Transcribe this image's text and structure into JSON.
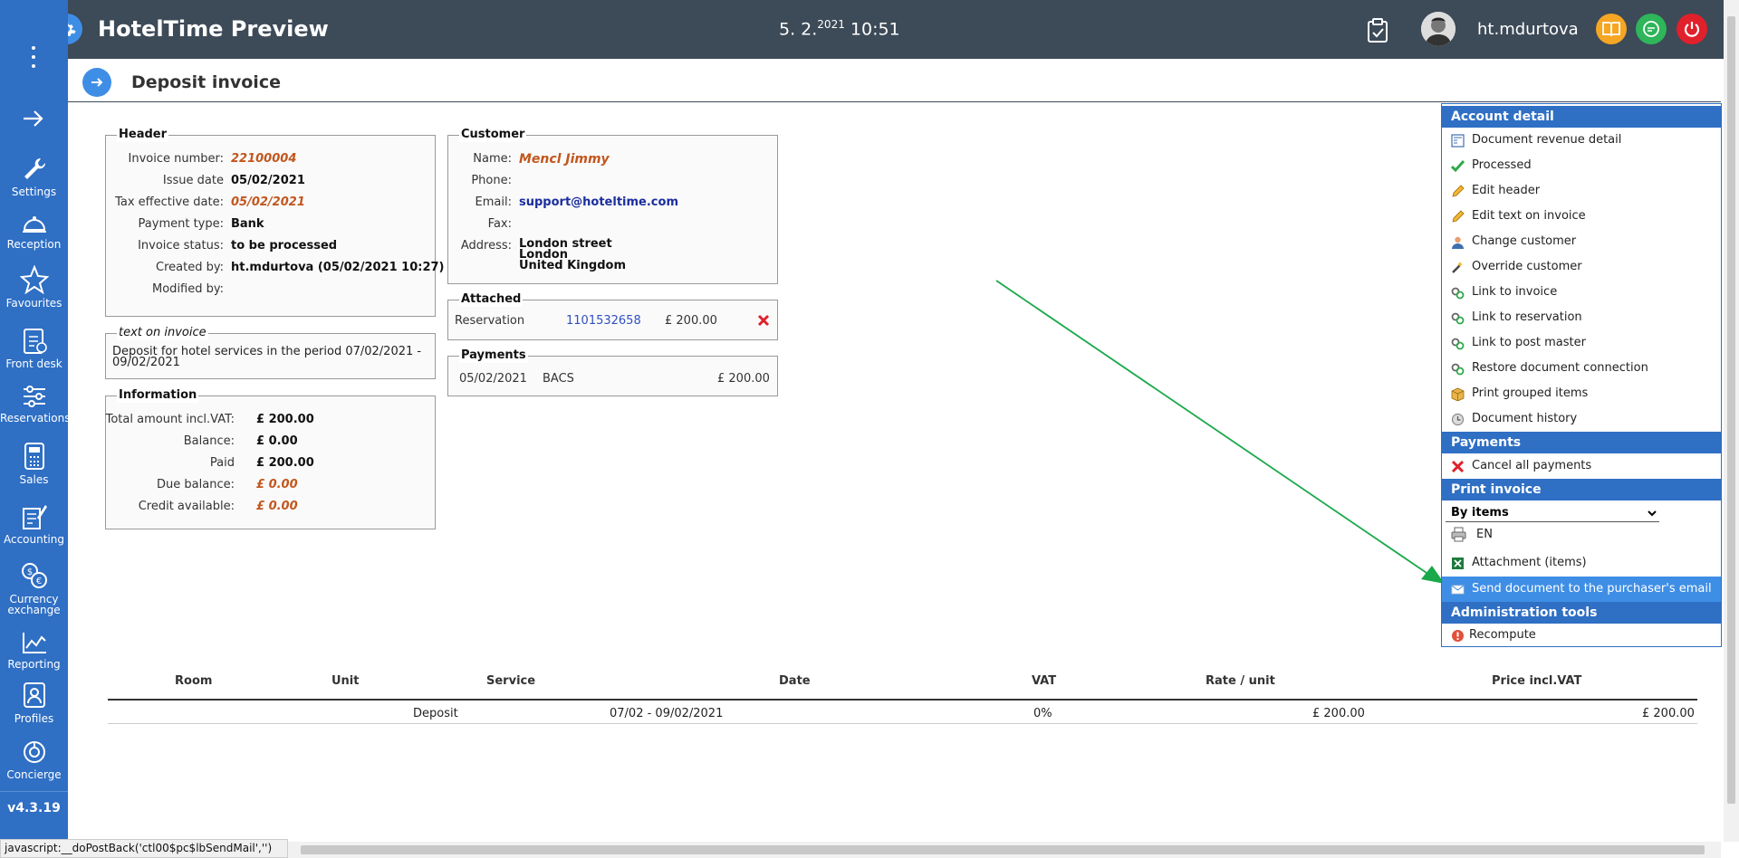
{
  "app": {
    "title": "HotelTime Preview",
    "date_main": "5. 2.",
    "date_year": "2021",
    "time": "10:51",
    "username": "ht.mdurtova"
  },
  "colors": {
    "topbar": "#3d4a58",
    "sidebar": "#2f6fc4",
    "accent": "#3f8ee6",
    "orange": "#c2561d",
    "arrow": "#19a84a"
  },
  "sidebar": {
    "items": [
      {
        "label": "Settings",
        "icon": "wrench-icon"
      },
      {
        "label": "Reception",
        "icon": "bell-icon"
      },
      {
        "label": "Favourites",
        "icon": "star-icon"
      },
      {
        "label": "Front desk",
        "icon": "clipboard-icon"
      },
      {
        "label": "Reservations",
        "icon": "sliders-icon"
      },
      {
        "label": "Sales",
        "icon": "calculator-icon"
      },
      {
        "label": "Accounting",
        "icon": "ledger-icon"
      },
      {
        "label": "Currency",
        "label2": "exchange",
        "icon": "currency-icon"
      },
      {
        "label": "Reporting",
        "icon": "chart-icon"
      },
      {
        "label": "Profiles",
        "icon": "profile-icon"
      },
      {
        "label": "Concierge",
        "icon": "concierge-icon"
      }
    ],
    "version": "v4.3.19"
  },
  "page": {
    "title": "Deposit invoice"
  },
  "header_box": {
    "title": "Header",
    "rows": [
      {
        "label": "Invoice number:",
        "value": "22100004"
      },
      {
        "label": "Issue date",
        "value": "05/02/2021"
      },
      {
        "label": "Tax effective date:",
        "value": "05/02/2021"
      },
      {
        "label": "Payment type:",
        "value": "Bank"
      },
      {
        "label": "Invoice status:",
        "value": "to be processed"
      },
      {
        "label": "Created by:",
        "value": "ht.mdurtova (05/02/2021 10:27)"
      },
      {
        "label": "Modified by:",
        "value": ""
      }
    ]
  },
  "text_box": {
    "title": "text on invoice",
    "text": "Deposit for hotel services in the period 07/02/2021 - 09/02/2021"
  },
  "info_box": {
    "title": "Information",
    "rows": [
      {
        "label": "Total amount incl.VAT:",
        "value": "£ 200.00"
      },
      {
        "label": "Balance:",
        "value": "£ 0.00"
      },
      {
        "label": "Paid",
        "value": "£ 200.00"
      },
      {
        "label": "Due balance:",
        "value": "£ 0.00"
      },
      {
        "label": "Credit available:",
        "value": "£ 0.00"
      }
    ]
  },
  "customer_box": {
    "title": "Customer",
    "name_label": "Name:",
    "name": "Mencl Jimmy",
    "phone_label": "Phone:",
    "phone": "",
    "email_label": "Email:",
    "email": "support@hoteltime.com",
    "fax_label": "Fax:",
    "fax": "",
    "address_label": "Address:",
    "address1": "London street",
    "address2": "London",
    "address3": "United Kingdom"
  },
  "attached_box": {
    "title": "Attached",
    "type": "Reservation",
    "number": "1101532658",
    "amount": "£ 200.00"
  },
  "payments_box": {
    "title": "Payments",
    "date": "05/02/2021",
    "method": "BACS",
    "amount": "£ 200.00"
  },
  "right_panel": {
    "account_detail": "Account detail",
    "items": [
      {
        "label": "Document revenue detail",
        "icon": "document-icon"
      },
      {
        "label": "Processed",
        "icon": "check-icon"
      },
      {
        "label": "Edit header",
        "icon": "pencil-icon"
      },
      {
        "label": "Edit text on invoice",
        "icon": "pencil-icon"
      },
      {
        "label": "Change customer",
        "icon": "person-icon"
      },
      {
        "label": "Override customer",
        "icon": "wand-icon"
      },
      {
        "label": "Link to invoice",
        "icon": "link-icon"
      },
      {
        "label": "Link to reservation",
        "icon": "link-icon"
      },
      {
        "label": "Link to post master",
        "icon": "link-icon"
      },
      {
        "label": "Restore document connection",
        "icon": "link-icon"
      },
      {
        "label": "Print grouped items",
        "icon": "box-icon"
      },
      {
        "label": "Document history",
        "icon": "history-icon"
      }
    ],
    "payments": "Payments",
    "cancel_payments": "Cancel all payments",
    "print_invoice": "Print invoice",
    "print_option": "By items",
    "print_lang": "EN",
    "attachment": "Attachment (items)",
    "send_email": "Send document to the purchaser's email",
    "admin_tools": "Administration tools",
    "recompute": "Recompute"
  },
  "table": {
    "headers": [
      "Room",
      "Unit",
      "Service",
      "Date",
      "VAT",
      "Rate / unit",
      "Price incl.VAT"
    ],
    "row": {
      "service": "Deposit",
      "date": "07/02 - 09/02/2021",
      "vat": "0%",
      "rate": "£ 200.00",
      "price": "£ 200.00"
    }
  },
  "statusbar": {
    "text": "javascript:__doPostBack('ctl00$pc$lbSendMail','')"
  }
}
